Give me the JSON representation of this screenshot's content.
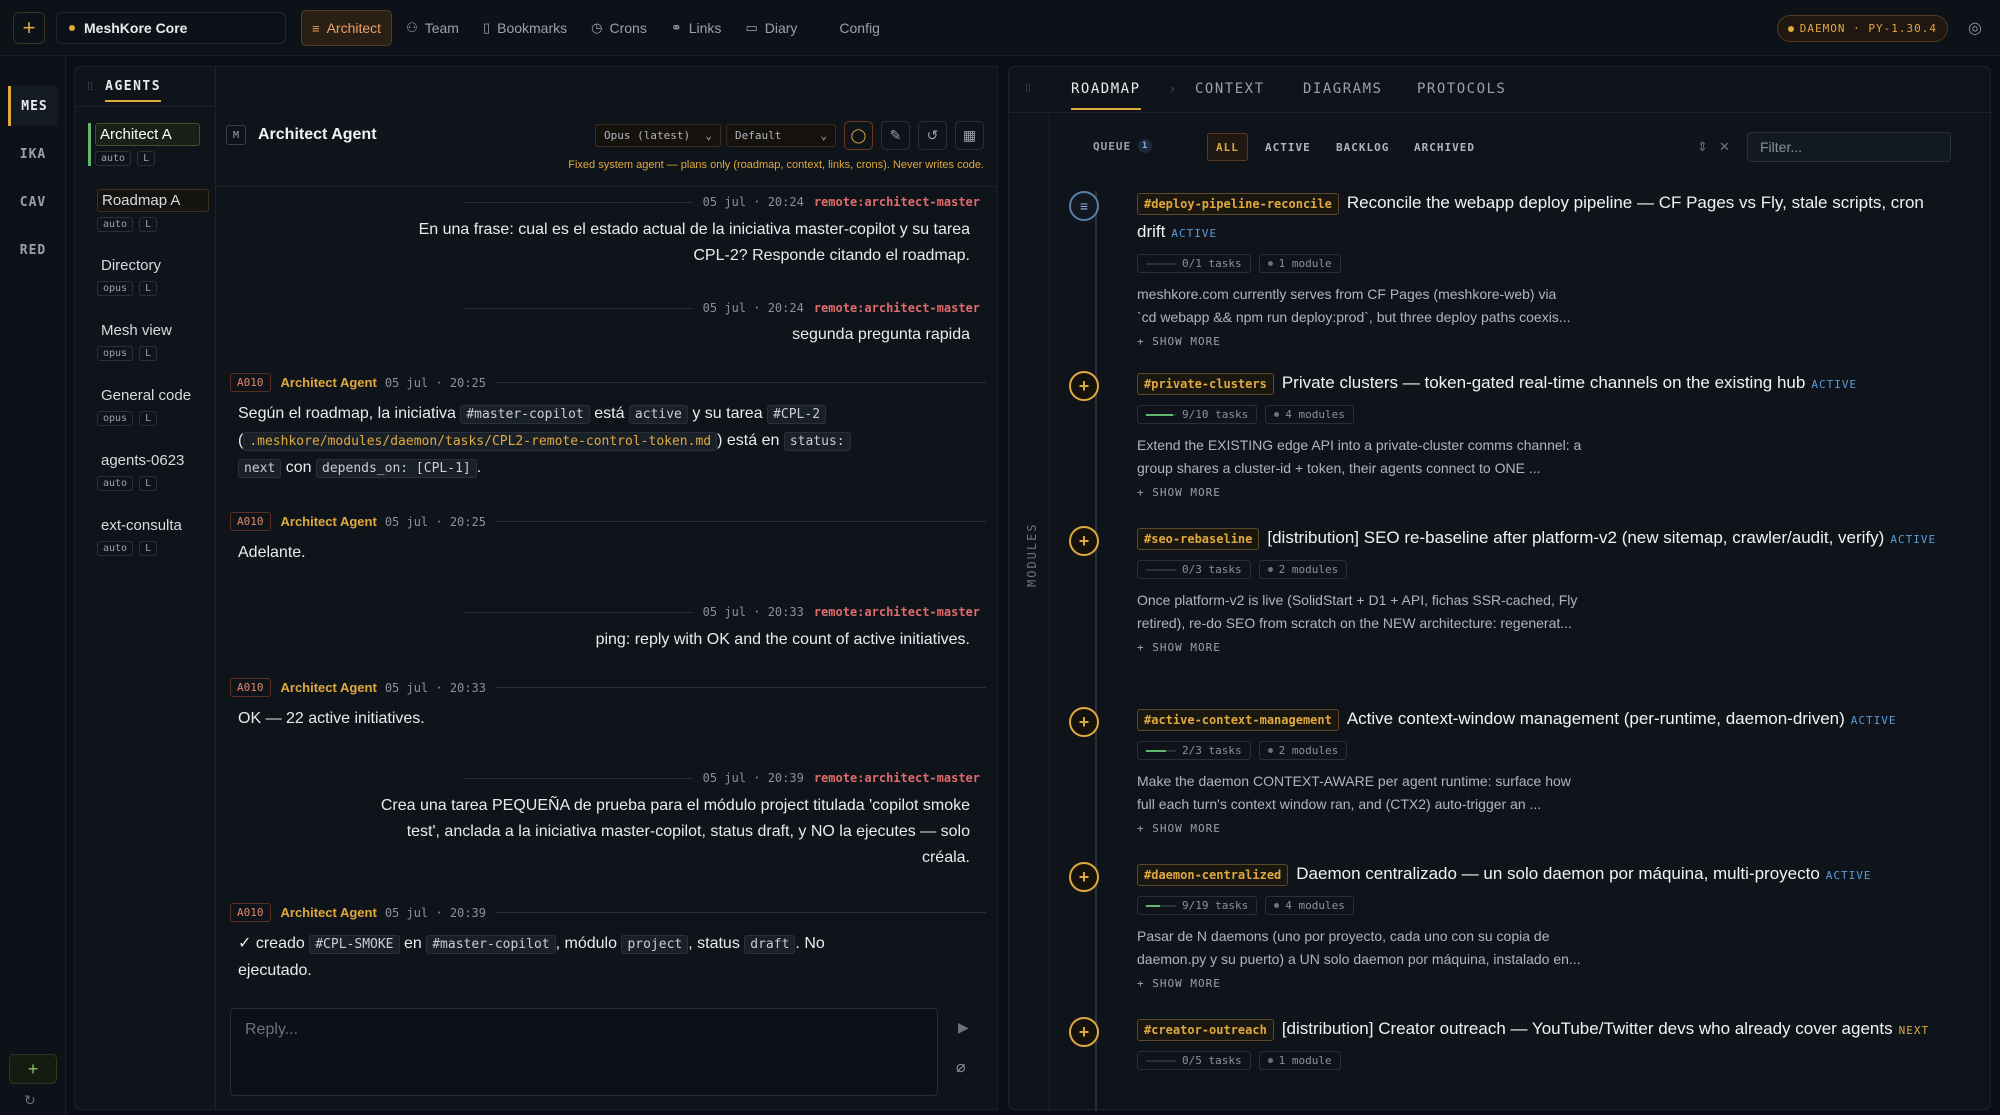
{
  "app": {
    "workspace": "MeshKore Core",
    "daemon": "DAEMON · PY-1.30.4"
  },
  "nav": [
    {
      "label": "Architect",
      "icon": "list-icon",
      "active": true
    },
    {
      "label": "Team",
      "icon": "users-icon"
    },
    {
      "label": "Bookmarks",
      "icon": "bookmark-icon"
    },
    {
      "label": "Crons",
      "icon": "clock-icon"
    },
    {
      "label": "Links",
      "icon": "link-icon"
    },
    {
      "label": "Diary",
      "icon": "book-icon"
    },
    {
      "label": "Config",
      "icon": ""
    }
  ],
  "rail": [
    "MES",
    "IKA",
    "CAV",
    "RED"
  ],
  "agents_panel": {
    "title": "AGENTS",
    "items": [
      {
        "name": "Architect A",
        "tags": [
          "auto",
          "L"
        ]
      },
      {
        "name": "Roadmap A",
        "tags": [
          "auto",
          "L"
        ]
      },
      {
        "name": "Directory",
        "tags": [
          "opus",
          "L"
        ]
      },
      {
        "name": "Mesh view",
        "tags": [
          "opus",
          "L"
        ]
      },
      {
        "name": "General code",
        "tags": [
          "opus",
          "L"
        ]
      },
      {
        "name": "agents-0623",
        "tags": [
          "auto",
          "L"
        ]
      },
      {
        "name": "ext-consulta",
        "tags": [
          "auto",
          "L"
        ]
      }
    ]
  },
  "chat": {
    "badge": "M",
    "title": "Architect Agent",
    "model": "Opus (latest)",
    "mode": "Default",
    "note": "Fixed system agent — plans only (roadmap, context, links, crons). Never writes code.",
    "reply_placeholder": "Reply...",
    "messages": [
      {
        "date": "05 jul · 20:24",
        "who": "remote:architect-master",
        "text": [
          "En una frase: cual es el estado actual de la iniciativa master-copilot y su tarea",
          "CPL-2? Responde citando el roadmap."
        ]
      },
      {
        "date": "05 jul · 20:24",
        "who": "remote:architect-master",
        "text": [
          "segunda pregunta rapida"
        ]
      },
      {
        "badge": "A010",
        "who": "Architect Agent",
        "date": "05 jul · 20:25"
      },
      {
        "badge": "A010",
        "who": "Architect Agent",
        "date": "05 jul · 20:25",
        "text": "Adelante."
      },
      {
        "date": "05 jul · 20:33",
        "who": "remote:architect-master",
        "text": [
          "ping: reply with OK and the count of active initiatives."
        ]
      },
      {
        "badge": "A010",
        "who": "Architect Agent",
        "date": "05 jul · 20:33",
        "text": "OK — 22 active initiatives."
      },
      {
        "date": "05 jul · 20:39",
        "who": "remote:architect-master",
        "text": [
          "Crea una tarea PEQUEÑA de prueba para el módulo project titulada 'copilot smoke",
          "test', anclada a la iniciativa master-copilot, status draft, y NO la ejecutes — solo",
          "créala."
        ]
      },
      {
        "badge": "A010",
        "who": "Architect Agent",
        "date": "05 jul · 20:39"
      }
    ],
    "msg3": {
      "t1": "Según el roadmap, la iniciativa",
      "c1": "#master-copilot",
      "t2": "está",
      "c2": "active",
      "t3": "y su tarea",
      "c3": "#CPL-2",
      "t4": "(",
      "c4": ".meshkore/modules/daemon/tasks/CPL2-remote-control-token.md",
      "t5": ") está en",
      "c5": "status:",
      "c6": "next",
      "t6": "con",
      "c7": "depends_on: [CPL-1]",
      "t7": "."
    },
    "msg8": {
      "t1": "✓ creado",
      "c1": "#CPL-SMOKE",
      "t2": "en",
      "c2": "#master-copilot",
      "t3": ", módulo",
      "c3": "project",
      "t4": ", status",
      "c4": "draft",
      "t5": ". No",
      "t6": "ejecutado."
    }
  },
  "roadmap": {
    "tabs": [
      "ROADMAP",
      "CONTEXT",
      "DIAGRAMS",
      "PROTOCOLS"
    ],
    "side_label": "MODULES",
    "queue": "QUEUE",
    "queue_count": "1",
    "filters": [
      "ALL",
      "ACTIVE",
      "BACKLOG",
      "ARCHIVED"
    ],
    "filter_placeholder": "Filter...",
    "show_more": "+ SHOW MORE",
    "items": [
      {
        "tag": "#deploy-pipeline-reconcile",
        "title": "Reconcile the webapp deploy pipeline — CF Pages vs Fly, stale scripts, cron drift",
        "status": "ACTIVE",
        "tasks": "0/1 tasks",
        "progress": 0.0,
        "modules": "1 module",
        "desc": [
          "meshkore.com currently serves from CF Pages (meshkore-web) via",
          "`cd webapp && npm run deploy:prod`, but three deploy paths coexis..."
        ]
      },
      {
        "tag": "#private-clusters",
        "title": "Private clusters — token-gated real-time channels on the existing hub",
        "status": "ACTIVE",
        "tasks": "9/10 tasks",
        "progress": 0.9,
        "modules": "4 modules",
        "desc": [
          "Extend the EXISTING edge API into a private-cluster comms channel: a",
          "group shares a cluster-id + token, their agents connect to ONE ..."
        ]
      },
      {
        "tag": "#seo-rebaseline",
        "title": "[distribution] SEO re-baseline after platform-v2 (new sitemap, crawler/audit, verify)",
        "status": "ACTIVE",
        "tasks": "0/3 tasks",
        "progress": 0.0,
        "modules": "2 modules",
        "desc": [
          "Once platform-v2 is live (SolidStart + D1 + API, fichas SSR-cached, Fly",
          "retired), re-do SEO from scratch on the NEW architecture: regenerat..."
        ]
      },
      {
        "tag": "#active-context-management",
        "title": "Active context-window management (per-runtime, daemon-driven)",
        "status": "ACTIVE",
        "tasks": "2/3 tasks",
        "progress": 0.67,
        "modules": "2 modules",
        "desc": [
          "Make the daemon CONTEXT-AWARE per agent runtime: surface how",
          "full each turn's context window ran, and (CTX2) auto-trigger an ..."
        ]
      },
      {
        "tag": "#daemon-centralized",
        "title": "Daemon centralizado — un solo daemon por máquina, multi-proyecto",
        "status": "ACTIVE",
        "tasks": "9/19 tasks",
        "progress": 0.47,
        "modules": "4 modules",
        "desc": [
          "Pasar de N daemons (uno por proyecto, cada uno con su copia de",
          "daemon.py y su puerto) a UN solo daemon por máquina, instalado en..."
        ]
      },
      {
        "tag": "#creator-outreach",
        "title": "[distribution] Creator outreach — YouTube/Twitter devs who already cover agents",
        "status": "NEXT",
        "tasks": "0/5 tasks",
        "progress": 0.0,
        "modules": "1 module",
        "desc": []
      }
    ]
  }
}
